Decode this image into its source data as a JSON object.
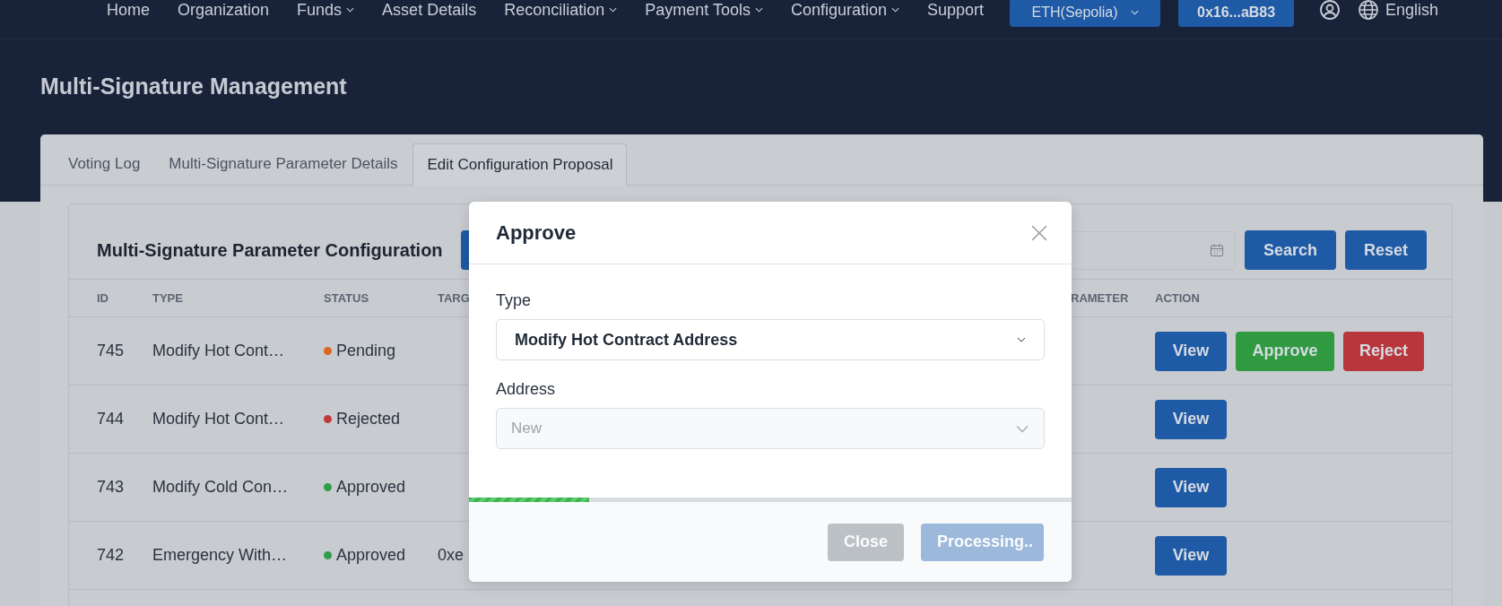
{
  "nav": {
    "items": [
      {
        "label": "Home",
        "has_menu": false
      },
      {
        "label": "Organization",
        "has_menu": false
      },
      {
        "label": "Funds",
        "has_menu": true
      },
      {
        "label": "Asset Details",
        "has_menu": false
      },
      {
        "label": "Reconciliation",
        "has_menu": true
      },
      {
        "label": "Payment Tools",
        "has_menu": true
      },
      {
        "label": "Configuration",
        "has_menu": true
      },
      {
        "label": "Support",
        "has_menu": false
      }
    ],
    "network_button": "ETH(Sepolia)",
    "wallet_button": "0x16...aB83",
    "language": "English"
  },
  "page_title": "Multi-Signature Management",
  "tabs": [
    {
      "label": "Voting Log",
      "selected": false
    },
    {
      "label": "Multi-Signature Parameter Details",
      "selected": false
    },
    {
      "label": "Edit Configuration Proposal",
      "selected": true
    }
  ],
  "panel": {
    "title": "Multi-Signature Parameter Configuration",
    "search_button": "Search",
    "reset_button": "Reset",
    "table": {
      "columns": [
        "ID",
        "TYPE",
        "STATUS",
        "TARG",
        "RAMETER",
        "ACTION"
      ],
      "rows": [
        {
          "id": "745",
          "type": "Modify Hot Cont…",
          "status": "Pending",
          "color": "#d9691e",
          "actions": [
            {
              "label": "View",
              "kind": "view"
            },
            {
              "label": "Approve",
              "kind": "approve"
            },
            {
              "label": "Reject",
              "kind": "reject"
            }
          ]
        },
        {
          "id": "744",
          "type": "Modify Hot Cont…",
          "status": "Rejected",
          "color": "#c33a3e",
          "actions": [
            {
              "label": "View",
              "kind": "view"
            }
          ]
        },
        {
          "id": "743",
          "type": "Modify Cold Con…",
          "status": "Approved",
          "color": "#2e9e48",
          "actions": [
            {
              "label": "View",
              "kind": "view"
            }
          ]
        },
        {
          "id": "742",
          "type": "Emergency With…",
          "status": "Approved",
          "color": "#2e9e48",
          "column_4": "0xe",
          "actions": [
            {
              "label": "View",
              "kind": "view"
            }
          ]
        }
      ]
    }
  },
  "dialog": {
    "title": "Approve",
    "fields": [
      {
        "label": "Type",
        "value": "Modify Hot Contract Address",
        "disabled": false
      },
      {
        "label": "Address",
        "placeholder": "New",
        "disabled": true
      }
    ],
    "progress": {
      "level": 0.2
    },
    "buttons": [
      {
        "label": "Close",
        "kind": "secondary",
        "disabled": true
      },
      {
        "label": "Processing..",
        "kind": "primary",
        "disabled": true
      }
    ]
  }
}
